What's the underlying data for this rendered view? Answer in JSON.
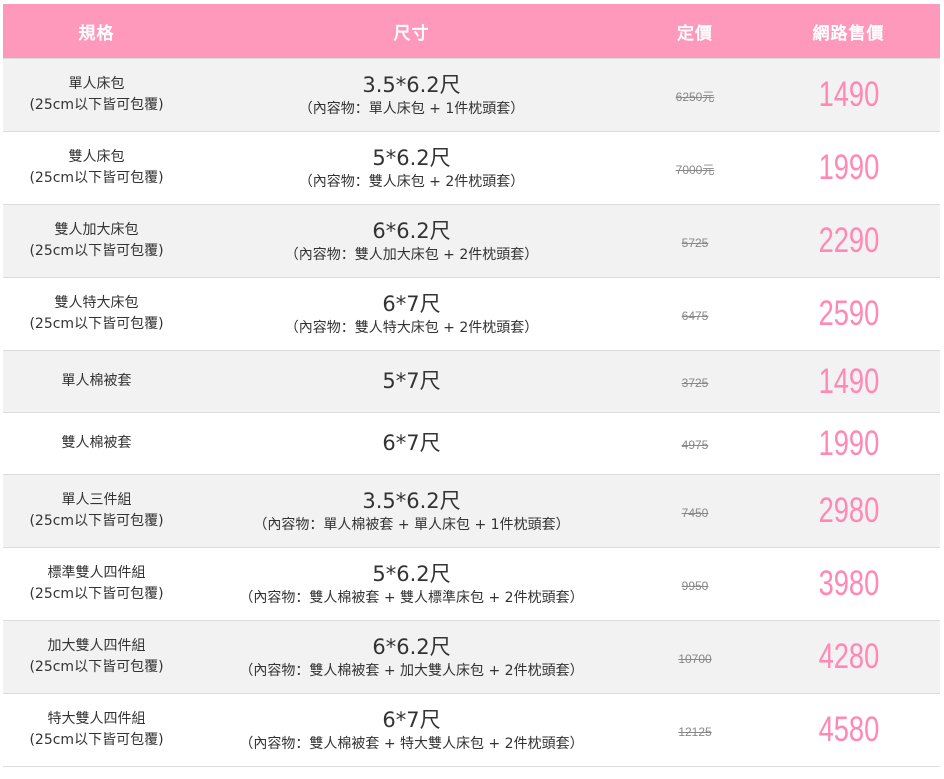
{
  "header": {
    "spec": "規格",
    "size": "尺寸",
    "list_price": "定價",
    "web_price": "網路售價"
  },
  "colors": {
    "header_bg": "#ff99bb",
    "price_pink": "#ff88b5",
    "row_shade": "#f2f2f2"
  },
  "rows": [
    {
      "name": "單人床包",
      "note": "(25cm以下皆可包覆)",
      "size": "3.5*6.2尺",
      "content": "（內容物：單人床包 + 1件枕頭套）",
      "list_price": "6250元",
      "web_price": "1490"
    },
    {
      "name": "雙人床包",
      "note": "(25cm以下皆可包覆)",
      "size": "5*6.2尺",
      "content": "（內容物：雙人床包 + 2件枕頭套）",
      "list_price": "7000元",
      "web_price": "1990"
    },
    {
      "name": "雙人加大床包",
      "note": "(25cm以下皆可包覆)",
      "size": "6*6.2尺",
      "content": "（內容物：雙人加大床包 + 2件枕頭套）",
      "list_price": "5725",
      "web_price": "2290"
    },
    {
      "name": "雙人特大床包",
      "note": "(25cm以下皆可包覆)",
      "size": "6*7尺",
      "content": "（內容物：雙人特大床包 + 2件枕頭套）",
      "list_price": "6475",
      "web_price": "2590"
    },
    {
      "name": "單人棉被套",
      "note": "",
      "size": "5*7尺",
      "content": "",
      "list_price": "3725",
      "web_price": "1490"
    },
    {
      "name": "雙人棉被套",
      "note": "",
      "size": "6*7尺",
      "content": "",
      "list_price": "4975",
      "web_price": "1990"
    },
    {
      "name": "單人三件組",
      "note": "(25cm以下皆可包覆)",
      "size": "3.5*6.2尺",
      "content": "（內容物：單人棉被套 + 單人床包 + 1件枕頭套）",
      "list_price": "7450",
      "web_price": "2980"
    },
    {
      "name": "標準雙人四件組",
      "note": "(25cm以下皆可包覆)",
      "size": "5*6.2尺",
      "content": "（內容物：雙人棉被套 + 雙人標準床包 + 2件枕頭套）",
      "list_price": "9950",
      "web_price": "3980"
    },
    {
      "name": "加大雙人四件組",
      "note": "(25cm以下皆可包覆)",
      "size": "6*6.2尺",
      "content": "（內容物：雙人棉被套 + 加大雙人床包 + 2件枕頭套）",
      "list_price": "10700",
      "web_price": "4280"
    },
    {
      "name": "特大雙人四件組",
      "note": "(25cm以下皆可包覆)",
      "size": "6*7尺",
      "content": "（內容物：雙人棉被套 + 特大雙人床包 + 2件枕頭套）",
      "list_price": "12125",
      "web_price": "4580"
    }
  ]
}
